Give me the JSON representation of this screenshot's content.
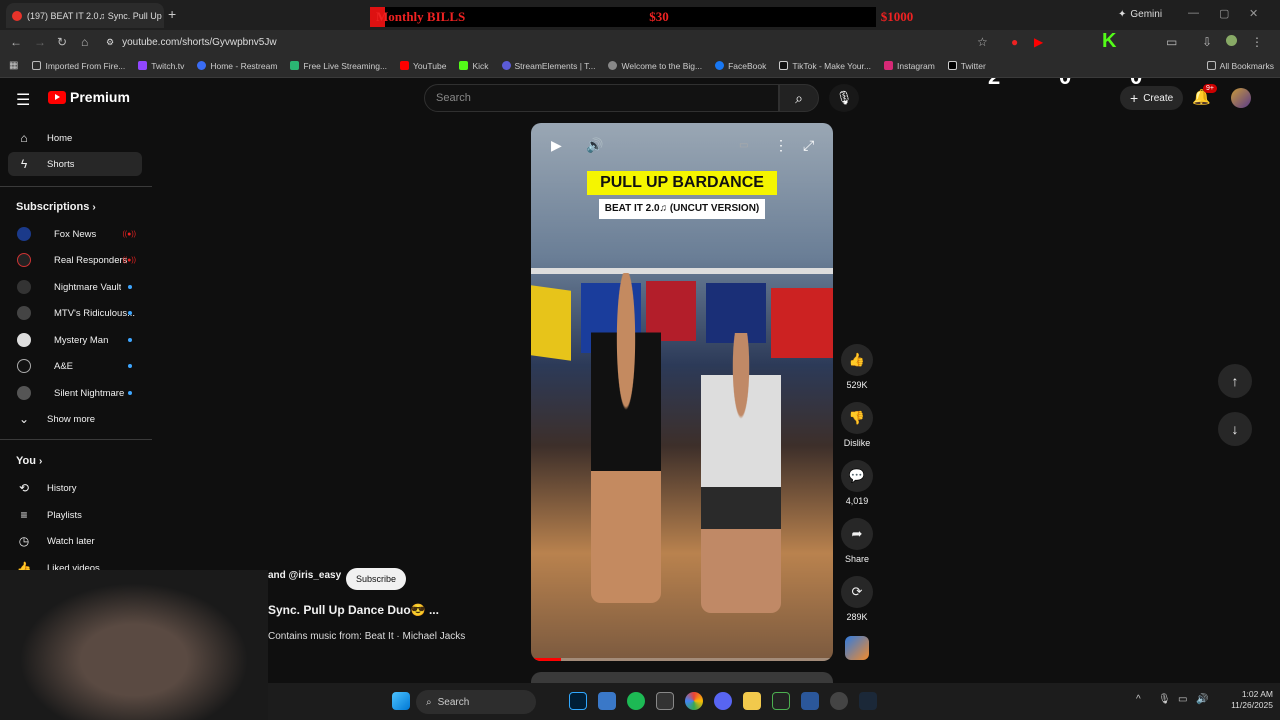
{
  "browser": {
    "tab_title": "(197) BEAT IT 2.0♫ Sync. Pull Up",
    "overlay_left": "Monthly BILLS",
    "overlay_mid": "$30",
    "overlay_right": "$1000",
    "overlay_progress": 0.03,
    "gemini_label": "Gemini",
    "url": "youtube.com/shorts/Gyvwpbnv5Jw",
    "all_bookmarks": "All Bookmarks",
    "bookmarks": [
      "Imported From Fire...",
      "Twitch.tv",
      "Home - Restream",
      "Free Live Streaming...",
      "YouTube",
      "Kick",
      "StreamElements | T...",
      "Welcome to the Big...",
      "FaceBook",
      "TikTok - Make Your...",
      "Instagram",
      "Twitter"
    ],
    "ext_counts": {
      "twitch": "2",
      "youtube": "0",
      "kick": "0"
    }
  },
  "youtube": {
    "logo": "Premium",
    "search_placeholder": "Search",
    "create_label": "Create",
    "notification_badge": "9+",
    "sidebar": {
      "home": "Home",
      "shorts": "Shorts",
      "subscriptions_header": "Subscriptions",
      "subscriptions": [
        "Fox News",
        "Real Responders",
        "Nightmare Vault",
        "MTV's Ridiculous...",
        "Mystery Man",
        "A&E",
        "Silent Nightmare"
      ],
      "show_more": "Show more",
      "you_header": "You",
      "you_items": [
        "History",
        "Playlists",
        "Watch later",
        "Liked videos"
      ]
    },
    "video": {
      "overlay_title": "PULL UP BARDANCE",
      "overlay_subtitle": "BEAT IT 2.0♫ (UNCUT VERSION)",
      "progress": 0.1,
      "channel": "and @iris_easy",
      "subscribe": "Subscribe",
      "title": "Sync. Pull Up Dance Duo😎 ...",
      "music": "Contains music from: Beat It · Michael Jacks"
    },
    "actions": {
      "likes": "529K",
      "dislike": "Dislike",
      "comments": "4,019",
      "share": "Share",
      "remix": "289K"
    }
  },
  "taskbar": {
    "search": "Search",
    "time": "1:02 AM",
    "date": "11/26/2025"
  },
  "colors": {
    "background": "#0f0f0f",
    "yt_red": "#ff0000",
    "overlay_yellow": "#f5f500"
  }
}
